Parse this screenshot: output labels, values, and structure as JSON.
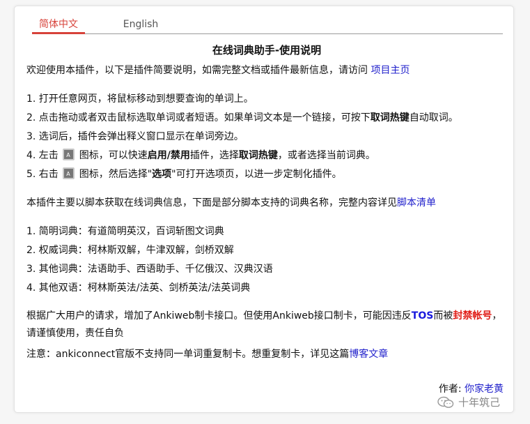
{
  "tabs": {
    "zh": "简体中文",
    "en": "English"
  },
  "title": "在线词典助手-使用说明",
  "intro": {
    "text": "欢迎使用本插件，以下是插件简要说明，如需完整文档或插件最新信息，请访问 ",
    "link": "项目主页"
  },
  "steps": {
    "s1": "1. 打开任意网页，将鼠标移动到想要查询的单词上。",
    "s2_a": "2. 点击拖动或者双击鼠标选取单词或者短语。如果单词文本是一个链接，可按下",
    "s2_b": "取词热键",
    "s2_c": "自动取词。",
    "s3": "3. 选词后，插件会弹出释义窗口显示在单词旁边。",
    "s4_a": "4. 左击 ",
    "s4_b": " 图标，可以快速",
    "s4_c": "启用/禁用",
    "s4_d": "插件，选择",
    "s4_e": "取词热键",
    "s4_f": "，或者选择当前词典。",
    "s5_a": "5. 右击 ",
    "s5_b": " 图标，然后选择\"",
    "s5_c": "选项",
    "s5_d": "\"可打开选项页，以进一步定制化插件。"
  },
  "scripts": {
    "text": "本插件主要以脚本获取在线词典信息，下面是部分脚本支持的词典名称，完整内容详见",
    "link": "脚本清单"
  },
  "dicts": {
    "d1": "1. 简明词典：有道简明英汉，百词斩图文词典",
    "d2": "2. 权威词典：柯林斯双解，牛津双解，剑桥双解",
    "d3": "3. 其他词典：法语助手、西语助手、千亿俄汉、汉典汉语",
    "d4": "4. 其他双语：柯林斯英法/法英、剑桥英法/法英词典"
  },
  "anki": {
    "a": "根据广大用户的请求，增加了Ankiweb制卡接口。但使用Ankiweb接口制卡，可能因违反",
    "tos": "TOS",
    "b": "而被",
    "ban": "封禁帐号",
    "c": "，请谨慎使用，责任自负"
  },
  "note": {
    "text": "注意：ankiconnect官版不支持同一单词重复制卡。想重复制卡，详见这篇",
    "link": "博客文章"
  },
  "author": {
    "label": "作者: ",
    "name": "你家老黄"
  },
  "watermark": "十年筑己",
  "icons": {
    "extension": "extension-icon",
    "watermark": "wechat-icon"
  },
  "colors": {
    "accent": "#d7423a",
    "link": "#2222cc",
    "warning": "#e0201a"
  }
}
